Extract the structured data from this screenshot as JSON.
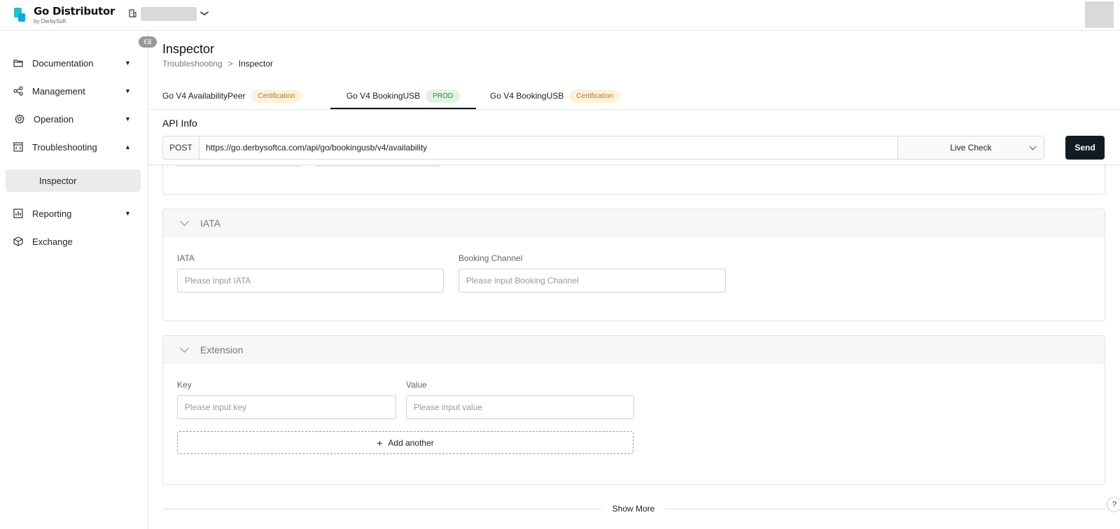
{
  "app": {
    "title": "Go Distributor",
    "subtitle": "by DerbySoft",
    "brand_color": "#19c5cf"
  },
  "sidebar": {
    "items": [
      {
        "label": "Documentation",
        "icon": "folder-icon",
        "expanded": false
      },
      {
        "label": "Management",
        "icon": "share-icon",
        "expanded": false
      },
      {
        "label": "Operation",
        "icon": "gear-icon",
        "expanded": false
      },
      {
        "label": "Troubleshooting",
        "icon": "code-window-icon",
        "expanded": true
      },
      {
        "label": "Reporting",
        "icon": "bar-chart-icon",
        "expanded": false
      },
      {
        "label": "Exchange",
        "icon": "cube-icon",
        "expanded": false
      }
    ],
    "sub_item": {
      "label": "Inspector",
      "selected": true
    }
  },
  "page": {
    "title": "Inspector",
    "breadcrumb": [
      "Troubleshooting",
      ">",
      "Inspector"
    ]
  },
  "tabs": [
    {
      "label": "Go V4 AvailabilityPeer",
      "badge": "Certification",
      "active": false
    },
    {
      "label": "Go V4 BookingUSB",
      "badge": "PROD",
      "active": true
    },
    {
      "label": "Go V4 BookingUSB",
      "badge": "Certification",
      "active": false
    }
  ],
  "api_info": {
    "title": "API Info",
    "method": "POST",
    "url": "https://go.derbysoftca.com/api/go/bookingusb/v4/availability",
    "mode": "Live Check",
    "send_label": "Send",
    "send_color": "#0f1c24"
  },
  "iata_section": {
    "title": "IATA",
    "fields": [
      {
        "label": "IATA",
        "placeholder": "Please input IATA"
      },
      {
        "label": "Booking Channel",
        "placeholder": "Please input Booking Channel"
      }
    ]
  },
  "extension_section": {
    "title": "Extension",
    "fields": [
      {
        "label": "Key",
        "placeholder": "Please input key"
      },
      {
        "label": "Value",
        "placeholder": "Please input value"
      }
    ],
    "add_label": "Add another"
  },
  "show_more_label": "Show More",
  "help_icon_text": "?"
}
